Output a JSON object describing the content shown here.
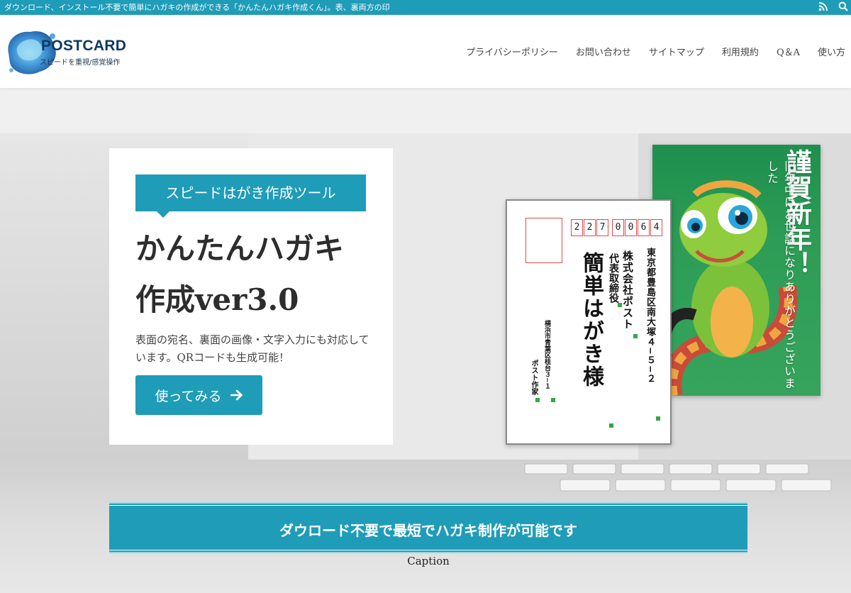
{
  "topbar": {
    "text": "ダウンロード、インストール不要で簡単にハガキの作成ができる「かんたんハガキ作成くん」。表、裏両方の印",
    "icons": [
      "rss-icon",
      "search-icon"
    ]
  },
  "header": {
    "logo_title": "POSTCARD",
    "logo_subtitle": "スピードを重視/感覚操作",
    "nav": [
      "プライバシーポリシー",
      "お問い合わせ",
      "サイトマップ",
      "利用規約",
      "Q＆A",
      "使い方"
    ]
  },
  "hero": {
    "ribbon": "スピードはがき作成ツール",
    "title_line1": "かんたんハガキ",
    "title_line2": "作成ver3.0",
    "description": "表面の宛名、裏面の画像・文字入力にも対応しています。QRコードも生成可能！",
    "button_label": "使ってみる",
    "button_icon": "arrow-right-icon"
  },
  "postcard_front": {
    "zip_digits": [
      "2",
      "2",
      "7",
      "0",
      "0",
      "6",
      "4"
    ],
    "address": "東京都豊島区南大塚４−５−２",
    "company": "株式会社ポスト",
    "role": "代表取締役",
    "name": "簡単はがき様",
    "sender_address": "横浜市青葉区桂台３−１",
    "sender_name": "ポスト作家"
  },
  "postcard_back": {
    "greeting": "謹賀新年！",
    "message": "旧年中はお世話になりありがとうございました"
  },
  "banner": {
    "text": "ダウロード不要で最短でハガキ制作が可能です",
    "caption": "Caption"
  },
  "colors": {
    "accent": "#1f9cb8",
    "zip_border": "#e14b4b",
    "dot": "#35a845"
  }
}
